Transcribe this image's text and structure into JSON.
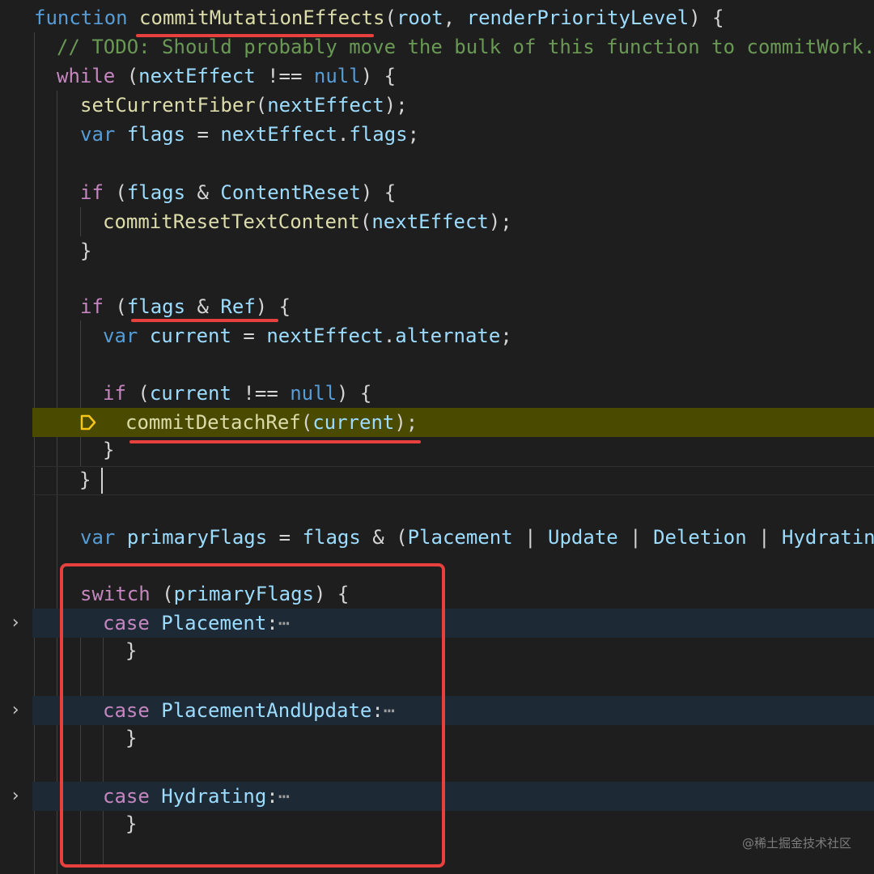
{
  "colors": {
    "background": "#1e1e1e",
    "keyword": "#569cd6",
    "control": "#c586c0",
    "function": "#dcdcaa",
    "variable": "#9cdcfe",
    "comment": "#6a9955",
    "annotation": "#e8403d",
    "debug_highlight": "#4a4a00",
    "folded_highlight": "#1d2a36"
  },
  "code": {
    "l1": {
      "kw": "function",
      "fn": "commitMutationEffects",
      "p1": "(",
      "a1": "root",
      "p2": ", ",
      "a2": "renderPriorityLevel",
      "p3": ") {"
    },
    "l2": {
      "comment": "// TODO: Should probably move the bulk of this function to commitWork."
    },
    "l3": {
      "kw": "while",
      "p1": " (",
      "v": "nextEffect",
      "p2": " !== ",
      "k2": "null",
      "p3": ") {"
    },
    "l4": {
      "fn": "setCurrentFiber",
      "p1": "(",
      "v": "nextEffect",
      "p2": ");"
    },
    "l5": {
      "kw": "var",
      "v1": "flags",
      "p1": " = ",
      "v2": "nextEffect",
      "p2": ".",
      "v3": "flags",
      "p3": ";"
    },
    "l7": {
      "kw": "if",
      "p1": " (",
      "v1": "flags",
      "p2": " & ",
      "v2": "ContentReset",
      "p3": ") {"
    },
    "l8": {
      "fn": "commitResetTextContent",
      "p1": "(",
      "v": "nextEffect",
      "p2": ");"
    },
    "l9": {
      "p": "}"
    },
    "l11": {
      "kw": "if",
      "p1": " (",
      "v1": "flags",
      "p2": " & ",
      "v2": "Ref",
      "p3": ") {"
    },
    "l12": {
      "kw": "var",
      "v1": "current",
      "p1": " = ",
      "v2": "nextEffect",
      "p2": ".",
      "v3": "alternate",
      "p3": ";"
    },
    "l14": {
      "kw": "if",
      "p1": " (",
      "v": "current",
      "p2": " !== ",
      "k2": "null",
      "p3": ") {"
    },
    "l15": {
      "fn": "commitDetachRef",
      "p1": "(",
      "v": "current",
      "p2": ");"
    },
    "l16": {
      "p": "}"
    },
    "l17": {
      "p": "}"
    },
    "l19": {
      "kw": "var",
      "v1": "primaryFlags",
      "p1": " = ",
      "v2": "flags",
      "p2": " & (",
      "t1": "Placement",
      "p3": " | ",
      "t2": "Update",
      "p4": " | ",
      "t3": "Deletion",
      "p5": " | ",
      "t4": "Hydrating"
    },
    "l21": {
      "kw": "switch",
      "p1": " (",
      "v": "primaryFlags",
      "p2": ") {"
    },
    "l22": {
      "kw": "case",
      "t": "Placement",
      "p": ":",
      "ell": "⋯"
    },
    "l23": {
      "p": "}"
    },
    "l25": {
      "kw": "case",
      "t": "PlacementAndUpdate",
      "p": ":",
      "ell": "⋯"
    },
    "l26": {
      "p": "}"
    },
    "l28": {
      "kw": "case",
      "t": "Hydrating",
      "p": ":",
      "ell": "⋯"
    },
    "l29": {
      "p": "}"
    }
  },
  "icons": {
    "fold_chevron": "›",
    "breakpoint": "debug-current-line-icon"
  },
  "watermark": "@稀土掘金技术社区"
}
